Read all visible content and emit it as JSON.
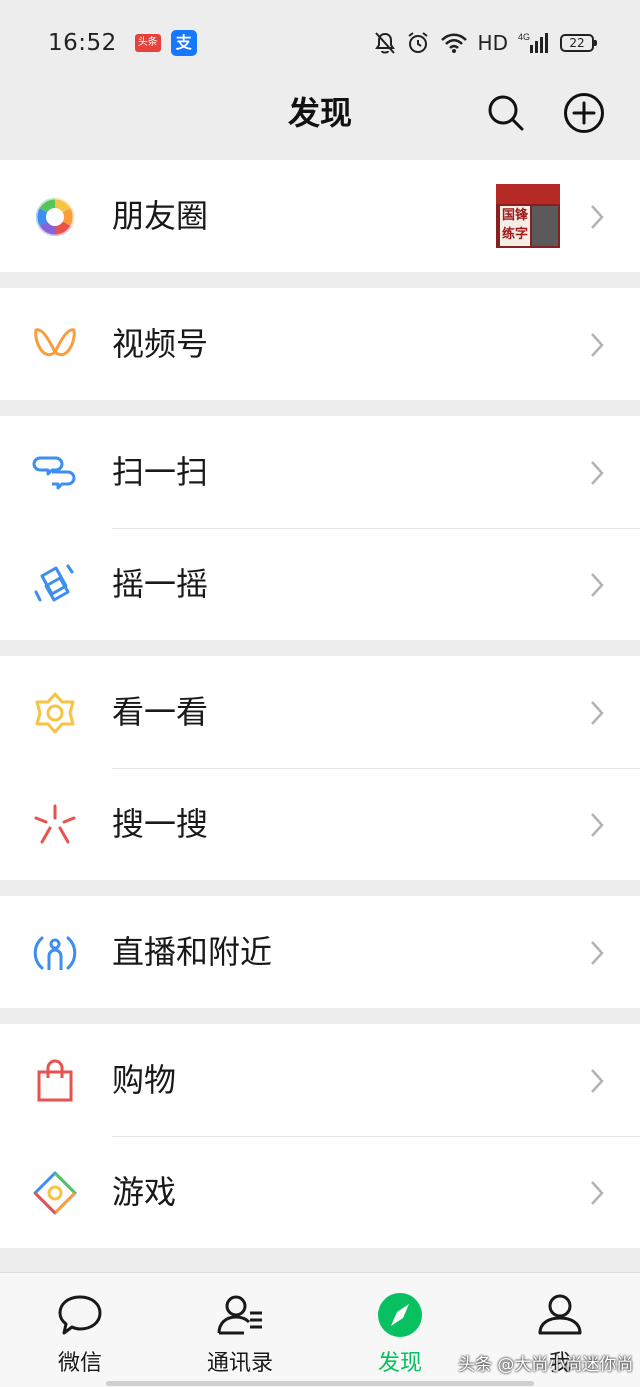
{
  "status_bar": {
    "time": "16:52",
    "toutiao_badge": "头条",
    "alipay_badge": "支",
    "network": "HD",
    "signal_label": "4G",
    "battery": "22",
    "icons": [
      "mute-bell-icon",
      "alarm-icon",
      "wifi-icon",
      "signal-icon",
      "battery-icon"
    ]
  },
  "header": {
    "title": "发现",
    "actions": [
      "search-icon",
      "add-circle-icon"
    ]
  },
  "groups": [
    {
      "rows": [
        {
          "key": "moments",
          "label": "朋友圈",
          "icon": "moments-aperture-icon",
          "thumbnail": {
            "line1": "国锋",
            "line2": "练字"
          }
        }
      ]
    },
    {
      "rows": [
        {
          "key": "channels",
          "label": "视频号",
          "icon": "channels-icon"
        }
      ]
    },
    {
      "rows": [
        {
          "key": "scan",
          "label": "扫一扫",
          "icon": "scan-icon"
        },
        {
          "key": "shake",
          "label": "摇一摇",
          "icon": "shake-icon"
        }
      ]
    },
    {
      "rows": [
        {
          "key": "top-stories",
          "label": "看一看",
          "icon": "top-stories-icon"
        },
        {
          "key": "search",
          "label": "搜一搜",
          "icon": "search-spark-icon"
        }
      ]
    },
    {
      "rows": [
        {
          "key": "live-nearby",
          "label": "直播和附近",
          "icon": "live-nearby-icon"
        }
      ]
    },
    {
      "rows": [
        {
          "key": "shopping",
          "label": "购物",
          "icon": "shopping-bag-icon"
        },
        {
          "key": "games",
          "label": "游戏",
          "icon": "games-icon"
        }
      ]
    }
  ],
  "tabbar": {
    "tabs": [
      {
        "label": "微信",
        "icon": "chat-bubble-icon",
        "active": false
      },
      {
        "label": "通讯录",
        "icon": "contacts-icon",
        "active": false
      },
      {
        "label": "发现",
        "icon": "discover-compass-icon",
        "active": true
      },
      {
        "label": "我",
        "icon": "me-person-icon",
        "active": false
      }
    ]
  },
  "watermark": "头条 @大尚小尚迷你尚",
  "colors": {
    "active_green": "#07c160",
    "background": "#ededed",
    "row_bg": "#ffffff"
  }
}
